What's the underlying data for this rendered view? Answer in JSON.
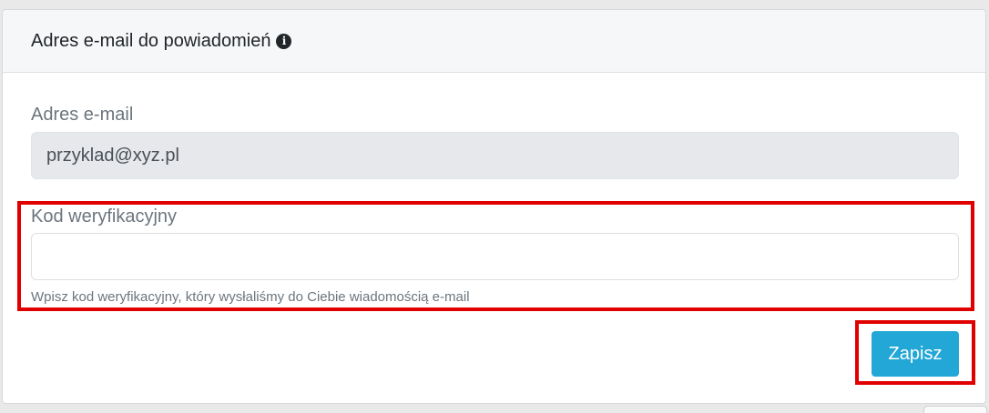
{
  "card": {
    "title": "Adres e-mail do powiadomień",
    "info_icon": "info-circle-icon"
  },
  "form": {
    "email_label": "Adres e-mail",
    "email_value": "przyklad@xyz.pl",
    "code_label": "Kod weryfikacyjny",
    "code_value": "",
    "code_help": "Wpisz kod weryfikacyjny, który wysłaliśmy do Ciebie wiadomością e-mail",
    "save_label": "Zapisz"
  },
  "colors": {
    "accent": "#22a7d7",
    "highlight": "#e00000"
  }
}
